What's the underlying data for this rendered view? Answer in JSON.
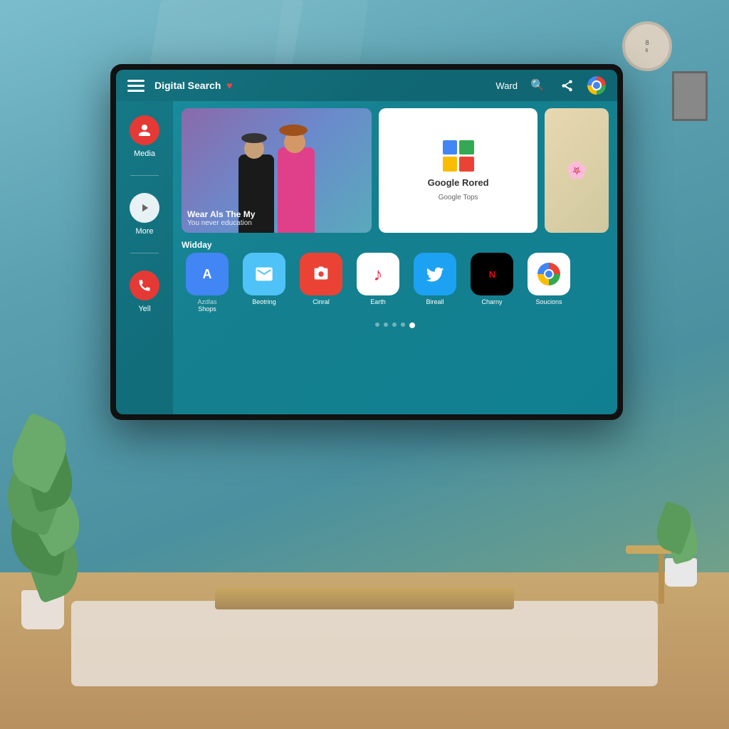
{
  "room": {
    "background_color": "#6baab8"
  },
  "tv": {
    "top_bar": {
      "menu_icon": "☰",
      "title": "Digital Search",
      "heart": "♥",
      "right_label": "Ward",
      "search_icon": "🔍",
      "share_icon": "⋘",
      "chrome_icon": "chrome"
    },
    "sidebar": {
      "items": [
        {
          "id": "media",
          "icon": "👤",
          "label": "Media",
          "icon_style": "red"
        },
        {
          "id": "more",
          "icon": "▶",
          "label": "More",
          "icon_style": "white"
        },
        {
          "id": "yell",
          "icon": "📞",
          "label": "Yell",
          "icon_style": "red-phone"
        }
      ]
    },
    "featured": {
      "show_title": "Wear Als The My",
      "show_subtitle": "You never education",
      "google_card_title": "Google Rored",
      "google_card_subtitle": "Google Tops",
      "google_card_icon": "store"
    },
    "apps_section": {
      "label": "Widday",
      "apps": [
        {
          "id": "azdlas",
          "label": "Shops",
          "icon_type": "blue",
          "icon_text": "A"
        },
        {
          "id": "mail",
          "label": "Beotring",
          "icon_type": "lightblue",
          "icon_text": "✉"
        },
        {
          "id": "camera",
          "label": "Cinral",
          "icon_type": "red",
          "icon_text": "📷"
        },
        {
          "id": "music",
          "label": "Earth",
          "icon_type": "white",
          "icon_text": "🎵"
        },
        {
          "id": "twitter",
          "label": "Bireall",
          "icon_type": "twitter",
          "icon_text": "🐦"
        },
        {
          "id": "netflix",
          "label": "Charny",
          "icon_type": "netflix",
          "icon_text": "NETFLIX"
        },
        {
          "id": "solutions",
          "label": "Soucions",
          "icon_type": "colorful",
          "icon_text": "🌐"
        }
      ]
    },
    "dots": [
      1,
      2,
      3,
      4,
      5
    ],
    "active_dot": 5
  }
}
